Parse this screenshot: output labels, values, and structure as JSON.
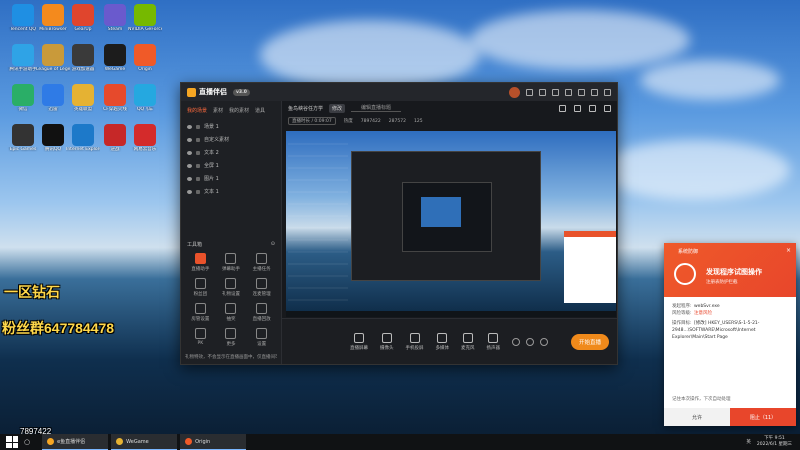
{
  "desktop": {
    "icons": [
      {
        "label": "Tencent QQ",
        "color": "#1f8fe3"
      },
      {
        "label": "MiniBrowser",
        "color": "#f48a1d"
      },
      {
        "label": "GearUp",
        "color": "#e0452d"
      },
      {
        "label": "Steam",
        "color": "#6a5acd"
      },
      {
        "label": "NVIDIA GeForce Experience",
        "color": "#76b900"
      },
      {
        "label": "腾讯手游助手",
        "color": "#2fa3e6"
      },
      {
        "label": "League of Legends",
        "color": "#c99a3a"
      },
      {
        "label": "游戏加速器",
        "color": "#3a3a3a"
      },
      {
        "label": "WeGame",
        "color": "#1c1c1c"
      },
      {
        "label": "Origin",
        "color": "#f05a28"
      },
      {
        "label": "微信",
        "color": "#2aae67"
      },
      {
        "label": "迅雷",
        "color": "#2f7be6"
      },
      {
        "label": "英雄联盟",
        "color": "#e5b233"
      },
      {
        "label": "CF穿越火线",
        "color": "#e64a2c"
      },
      {
        "label": "QQ飞车",
        "color": "#25a8e0"
      },
      {
        "label": "Epic Games",
        "color": "#333"
      },
      {
        "label": "腾讯QQ",
        "color": "#111"
      },
      {
        "label": "Internet Explorer",
        "color": "#1d79c9"
      },
      {
        "label": "逆战",
        "color": "#c62828"
      },
      {
        "label": "网易云音乐",
        "color": "#d42b2b"
      }
    ],
    "overlay": {
      "line1": "一区钻石",
      "line2": "粉丝群647784478",
      "badge_number": "7897422"
    }
  },
  "app": {
    "title": "直播伴侣",
    "version": "v3.0",
    "sidebar_tabs": [
      "我的场景",
      "素材",
      "我的素材",
      "道具"
    ],
    "scenes": [
      "场景 1",
      "自定义素材",
      "文本 2",
      "全屏 1",
      "图片 1",
      "文本 1"
    ],
    "tools_title": "工具箱",
    "tools": [
      {
        "label": "直播助手",
        "active": true
      },
      {
        "label": "弹幕助手",
        "active": false
      },
      {
        "label": "主播任务",
        "active": false
      },
      {
        "label": "粉丝团",
        "active": false
      },
      {
        "label": "礼物设置",
        "active": false
      },
      {
        "label": "连麦管理",
        "active": false
      },
      {
        "label": "房管设置",
        "active": false
      },
      {
        "label": "抽奖",
        "active": false
      },
      {
        "label": "直播回放",
        "active": false
      },
      {
        "label": "PK",
        "active": false
      },
      {
        "label": "更多",
        "active": false
      },
      {
        "label": "设置",
        "active": false
      }
    ],
    "footer_text": "礼物特效，不会显示在直播画面中，仅直播间可见",
    "room_title": "鱼鸟峡谷任方学",
    "room_tag": "修改",
    "room_edit": "编辑直播标题",
    "stats": {
      "label": "直播时长",
      "duration": "/ 0:09:07",
      "viewers_label": "热度",
      "viewers": "7897422",
      "likes": "287572",
      "comments": "125"
    },
    "bottom_tools": [
      "直播屏幕",
      "摄像头",
      "手机投屏",
      "多媒体",
      "麦克风",
      "扬声器"
    ],
    "live_button": "开始直播"
  },
  "notification": {
    "header": "系统防御",
    "title": "发现程序试图操作",
    "subtitle": "注册表防护拦截",
    "program_label": "发起程序:",
    "program_value": "webSvr.exe",
    "risk_label": "风险等级:",
    "risk_value": "注意风险",
    "op_label": "操作目标:",
    "op_value": "[修改] HKEY_USERS\\S-1-5-21-2948...\\SOFTWARE\\Microsoft\\Internet Explorer\\Main\\Start Page",
    "checkbox": "记住本次操作，下次自动处理",
    "allow": "允许",
    "block": "阻止（11）"
  },
  "taskbar": {
    "items": [
      {
        "label": "e鱼直播伴侣",
        "color": "#f6a623",
        "wide": true
      },
      {
        "label": "WeGame",
        "color": "#e5b233",
        "wide": true
      },
      {
        "label": "Origin",
        "color": "#f05a28",
        "wide": true
      }
    ],
    "time": "下午 9:51",
    "date": "2022/6/1 星期三",
    "lang": "英"
  }
}
